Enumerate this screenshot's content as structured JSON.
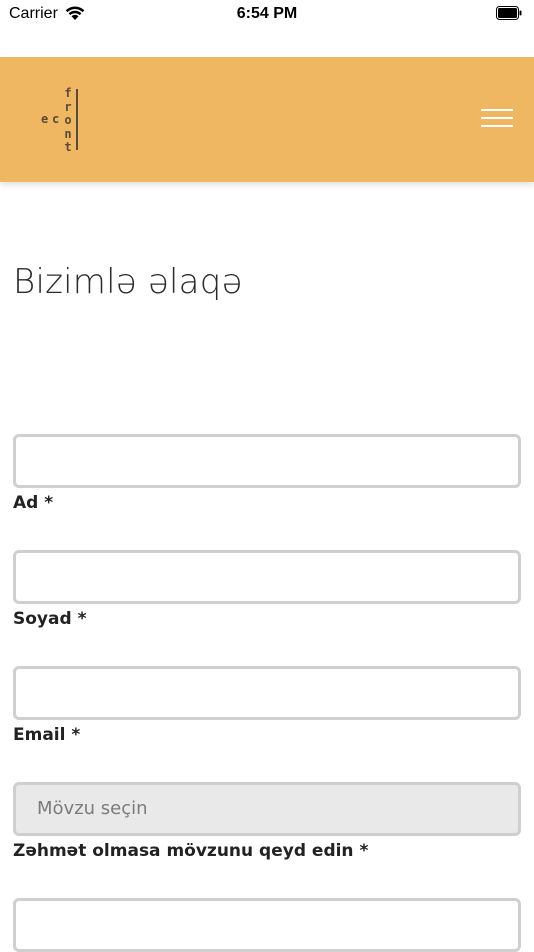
{
  "status_bar": {
    "carrier": "Carrier",
    "time": "6:54 PM"
  },
  "header": {
    "logo": {
      "left_letters": [
        "e",
        "c"
      ],
      "stack_letters": [
        "f",
        "r",
        "o",
        "n",
        "t"
      ]
    },
    "menu_icon": "hamburger-icon",
    "background_color": "#f0b763"
  },
  "page": {
    "title": "Bizimlə əlaqə"
  },
  "form": {
    "first_name": {
      "value": "",
      "label": "Ad *"
    },
    "last_name": {
      "value": "",
      "label": "Soyad *"
    },
    "email": {
      "value": "",
      "label": "Email *"
    },
    "subject": {
      "selected": "Mövzu seçin",
      "label": "Zəhmət olmasa mövzunu qeyd edin *"
    },
    "message": {
      "value": ""
    }
  }
}
